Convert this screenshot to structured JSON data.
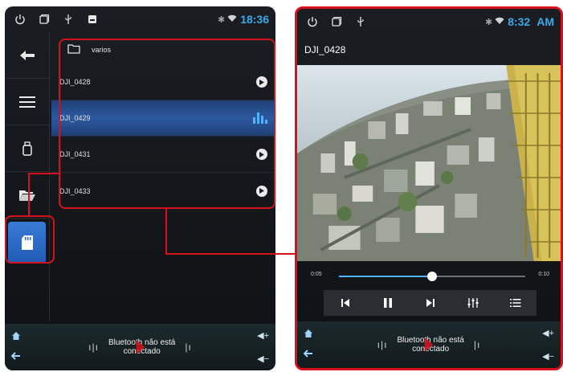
{
  "left": {
    "status": {
      "time": "18:36"
    },
    "folder": {
      "name": "varios"
    },
    "files": [
      {
        "name": "DJI_0428",
        "state": "play"
      },
      {
        "name": "DJI_0429",
        "state": "playing"
      },
      {
        "name": "DJI_0431",
        "state": "play"
      },
      {
        "name": "DJI_0433",
        "state": "play"
      }
    ],
    "sidebar": [
      "back-arrow-icon",
      "menu-icon",
      "usb-drive-icon",
      "folder-open-icon",
      "sd-card-icon"
    ],
    "bottom": {
      "bt_line1": "Bluetooth não está",
      "bt_line2": "conectado"
    }
  },
  "right": {
    "status": {
      "time": "8:32",
      "ampm": "AM"
    },
    "title": "DJI_0428",
    "player": {
      "elapsed": "0:05",
      "total": "0:10",
      "progress": 0.5
    },
    "bottom": {
      "bt_line1": "Bluetooth não está",
      "bt_line2": "conectado"
    }
  },
  "colors": {
    "accent": "#3da9e8",
    "highlight": "#d6111c",
    "active_row": "#2c5aa0"
  }
}
